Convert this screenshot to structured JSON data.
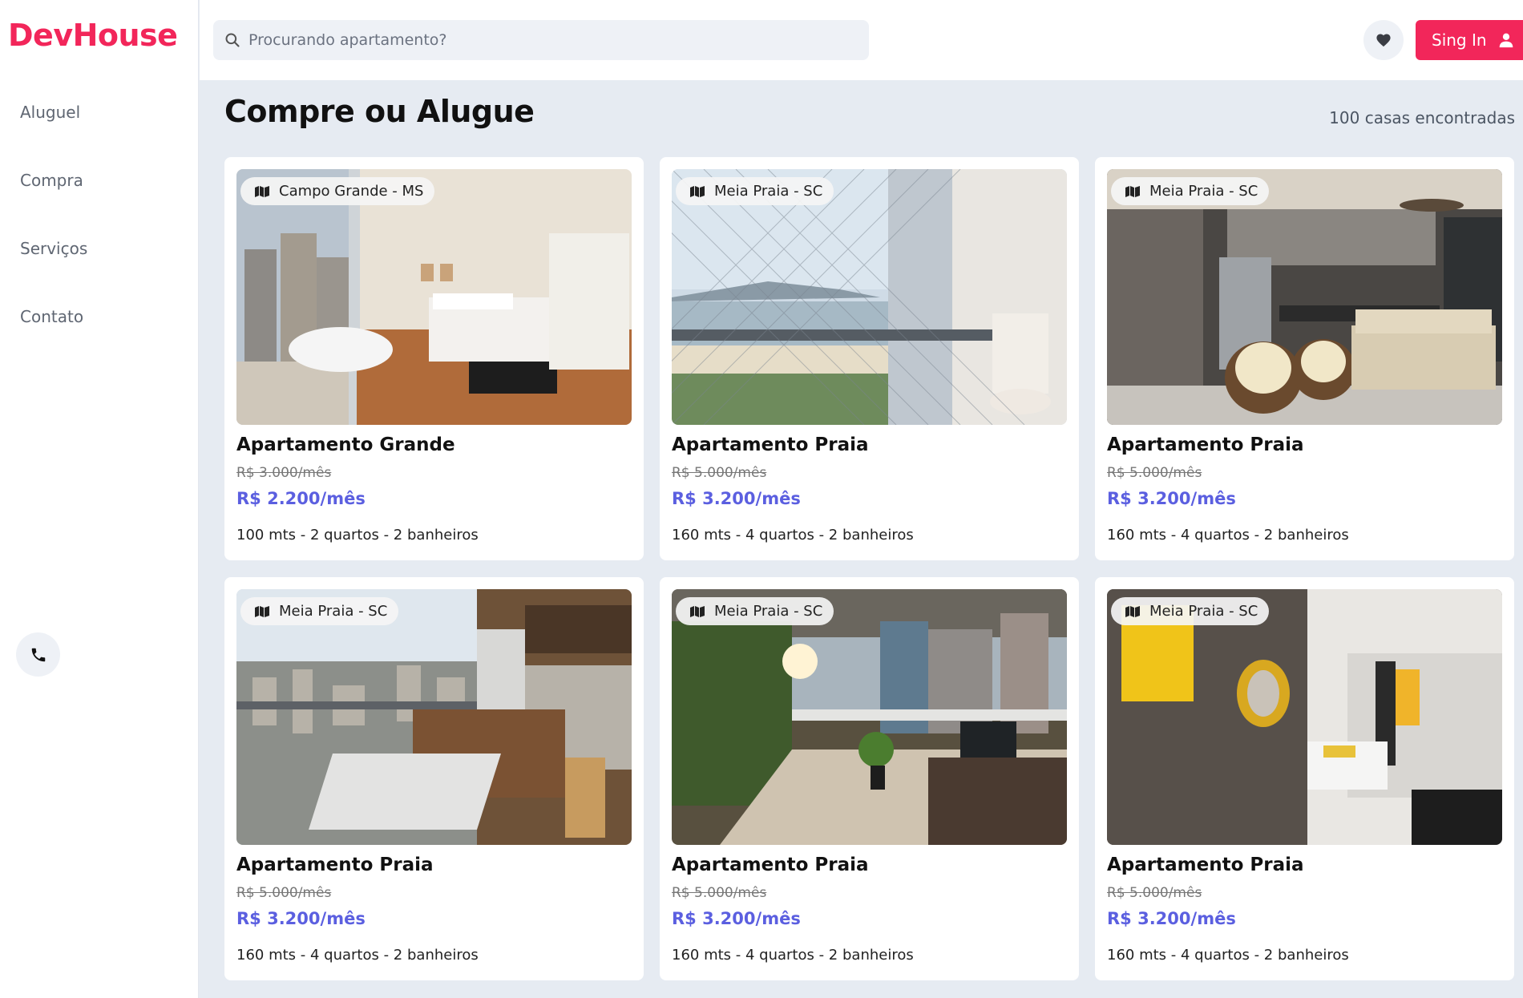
{
  "brand": {
    "logo": "DevHouse",
    "accent": "#f2265a",
    "price_color": "#5b5fe0"
  },
  "sidebar": {
    "items": [
      {
        "label": "Aluguel"
      },
      {
        "label": "Compra"
      },
      {
        "label": "Serviços"
      },
      {
        "label": "Contato"
      }
    ],
    "phone_icon": "phone-icon"
  },
  "header": {
    "search_placeholder": "Procurando apartamento?",
    "search_icon": "search-icon",
    "favorites_icon": "heart-icon",
    "signin_label": "Sing In",
    "signin_icon": "user-icon"
  },
  "main": {
    "title": "Compre ou Alugue",
    "count": "100 casas encontradas",
    "listings": [
      {
        "location": "Campo Grande - MS",
        "title": "Apartamento Grande",
        "old_price": "R$ 3.000/mês",
        "price": "R$ 2.200/mês",
        "specs": "100 mts - 2 quartos - 2 banheiros",
        "photo": "bedroom"
      },
      {
        "location": "Meia Praia - SC",
        "title": "Apartamento Praia",
        "old_price": "R$ 5.000/mês",
        "price": "R$ 3.200/mês",
        "specs": "160 mts - 4 quartos - 2 banheiros",
        "photo": "beach-balcony"
      },
      {
        "location": "Meia Praia - SC",
        "title": "Apartamento Praia",
        "old_price": "R$ 5.000/mês",
        "price": "R$ 3.200/mês",
        "specs": "160 mts - 4 quartos - 2 banheiros",
        "photo": "kitchen-living"
      },
      {
        "location": "Meia Praia - SC",
        "title": "Apartamento Praia",
        "old_price": "R$ 5.000/mês",
        "price": "R$ 3.200/mês",
        "specs": "160 mts - 4 quartos - 2 banheiros",
        "photo": "city-balcony"
      },
      {
        "location": "Meia Praia - SC",
        "title": "Apartamento Praia",
        "old_price": "R$ 5.000/mês",
        "price": "R$ 3.200/mês",
        "specs": "160 mts - 4 quartos - 2 banheiros",
        "photo": "terrace"
      },
      {
        "location": "Meia Praia - SC",
        "title": "Apartamento Praia",
        "old_price": "R$ 5.000/mês",
        "price": "R$ 3.200/mês",
        "specs": "160 mts - 4 quartos - 2 banheiros",
        "photo": "studio"
      }
    ]
  }
}
